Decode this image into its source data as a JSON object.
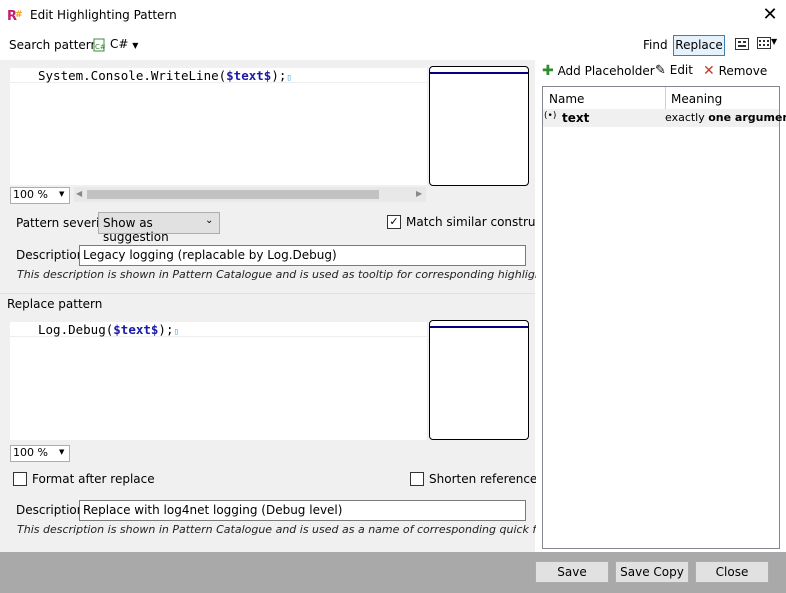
{
  "window": {
    "title": "Edit Highlighting Pattern",
    "close_icon": "close-icon"
  },
  "search": {
    "label": "Search pattern",
    "language": "C#",
    "mode_find": "Find",
    "mode_replace": "Replace",
    "code": "System.Console.WriteLine($text$);",
    "code_plain_before": "System.Console.WriteLine(",
    "code_placeholder": "$text$",
    "code_plain_after": ");",
    "zoom": "100 %",
    "severity_label": "Pattern severity",
    "severity_value": "Show as suggestion",
    "match_similar_label": "Match similar constructs",
    "match_similar_checked": true,
    "description_label": "Description",
    "description_value": "Legacy logging (replacable by Log.Debug)",
    "description_note": "This description is shown in Pattern Catalogue and is used as tooltip for corresponding highlighting"
  },
  "replace": {
    "label": "Replace pattern",
    "code_plain_before": "Log.Debug(",
    "code_placeholder": "$text$",
    "code_plain_after": ");",
    "zoom": "100 %",
    "format_label": "Format after replace",
    "format_checked": false,
    "shorten_label": "Shorten references",
    "shorten_checked": false,
    "description_label": "Description",
    "description_value": "Replace with log4net logging (Debug level)",
    "description_note": "This description is shown in Pattern Catalogue and is used as a name of corresponding quick fix"
  },
  "placeholders": {
    "add_label": "Add Placeholder",
    "edit_label": "Edit",
    "remove_label": "Remove",
    "columns": [
      "Name",
      "Meaning"
    ],
    "rows": [
      {
        "icon": "(•)",
        "name": "text",
        "meaning_prefix": "exactly ",
        "meaning_bold": "one argument"
      }
    ]
  },
  "footer": {
    "save": "Save",
    "save_copy": "Save Copy",
    "close": "Close"
  },
  "colors": {
    "placeholder": "#1a1aa6",
    "accent": "#0078d7",
    "footer_bg": "#a9a9a9"
  }
}
